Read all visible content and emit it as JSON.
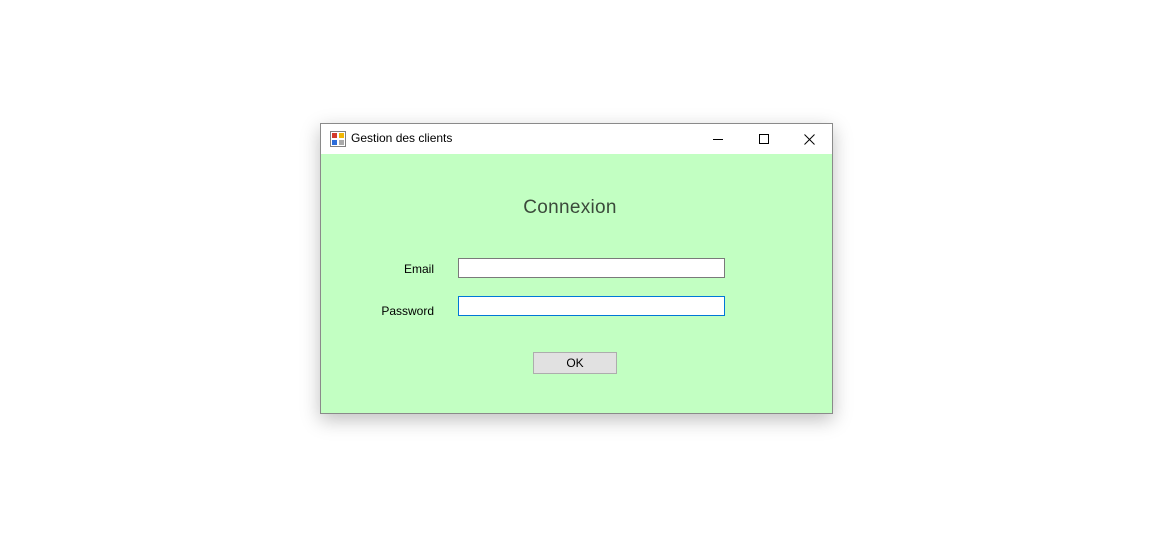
{
  "window": {
    "title": "Gestion des clients",
    "controls": [
      "minimize",
      "maximize",
      "close"
    ],
    "background_color": "#c2ffc2"
  },
  "form": {
    "heading": "Connexion",
    "email_label": "Email",
    "email_value": "",
    "password_label": "Password",
    "password_value": "",
    "ok_label": "OK"
  },
  "icons": {
    "app": "app-icon",
    "minimize": "minimize-icon",
    "maximize": "maximize-icon",
    "close": "close-icon"
  },
  "colors": {
    "focus_border": "#0078d7",
    "button_bg": "#e1e1e1"
  }
}
